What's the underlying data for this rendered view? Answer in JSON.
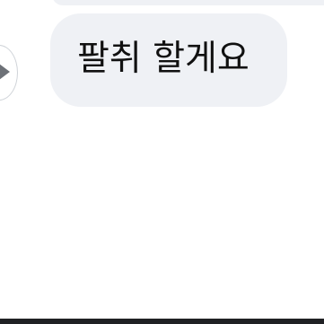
{
  "chat": {
    "messages": [
      {
        "text": "팔취 할게요"
      }
    ]
  },
  "icons": {
    "avatar_icon": "play-triangle-icon"
  },
  "colors": {
    "bubble_bg": "#eff1f5",
    "text": "#111111",
    "bottom_bar": "#202124"
  }
}
